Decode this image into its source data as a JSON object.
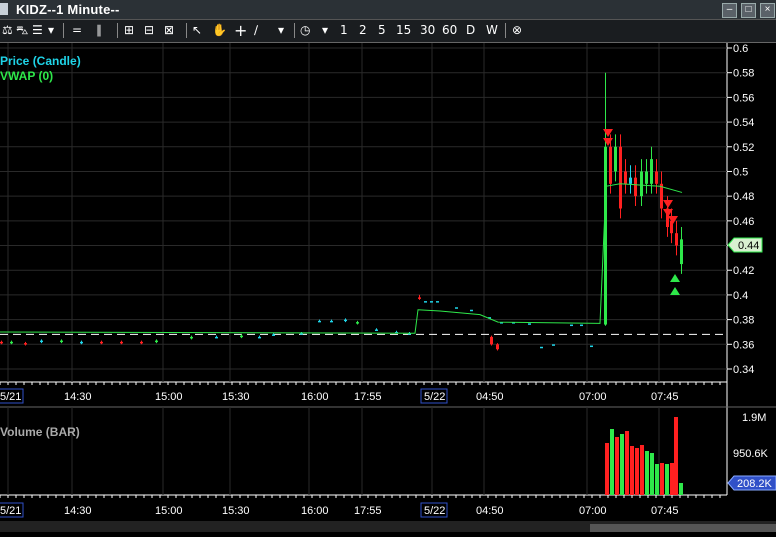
{
  "window": {
    "title": "KIDZ--1 Minute--",
    "min_label": "–",
    "max_label": "□",
    "close_label": "×"
  },
  "toolbar": {
    "items_left": [
      "⚖",
      "⛍",
      "☰",
      "▾",
      "=",
      "∥",
      "⊞",
      "⊟",
      "⊠",
      "↖",
      "✋",
      "+",
      "∕",
      "▾",
      "◷",
      "▾"
    ],
    "intervals": [
      "1",
      "2",
      "5",
      "15",
      "30",
      "60",
      "D",
      "W"
    ],
    "close_glyph": "⊗"
  },
  "price_panel": {
    "legend": [
      "Price (Candle)",
      "VWAP (0)"
    ],
    "legend_colors": [
      "#1fd4e8",
      "#2ee84a"
    ],
    "y_ticks": [
      "0.6",
      "0.58",
      "0.56",
      "0.54",
      "0.52",
      "0.5",
      "0.48",
      "0.46",
      "0.44",
      "0.42",
      "0.4",
      "0.38",
      "0.36",
      "0.34"
    ],
    "last_price_label": "0.44"
  },
  "volume_panel": {
    "legend": "Volume (BAR)",
    "y_ticks": [
      "1.9M",
      "950.6K"
    ],
    "last_volume_label": "208.2K"
  },
  "x_axis": {
    "labels": [
      "5/21",
      "14:30",
      "15:00",
      "15:30",
      "16:00",
      "17:55",
      "5/22",
      "04:50",
      "07:00",
      "07:45"
    ]
  },
  "chart_data": {
    "type": "candlestick",
    "title": "KIDZ--1 Minute--",
    "series": [
      {
        "name": "Price (Candle)"
      },
      {
        "name": "VWAP (0)"
      },
      {
        "name": "Volume (BAR)"
      }
    ],
    "ylim": [
      0.33,
      0.6
    ],
    "reference_line": 0.368,
    "last_price": 0.44,
    "last_volume": "208.2K",
    "volume_ylim_label": "1.9M",
    "colors": {
      "up": "#2ee84a",
      "down": "#ff2020",
      "neutral": "#1fd4e8",
      "vwap": "#2ee84a"
    }
  }
}
